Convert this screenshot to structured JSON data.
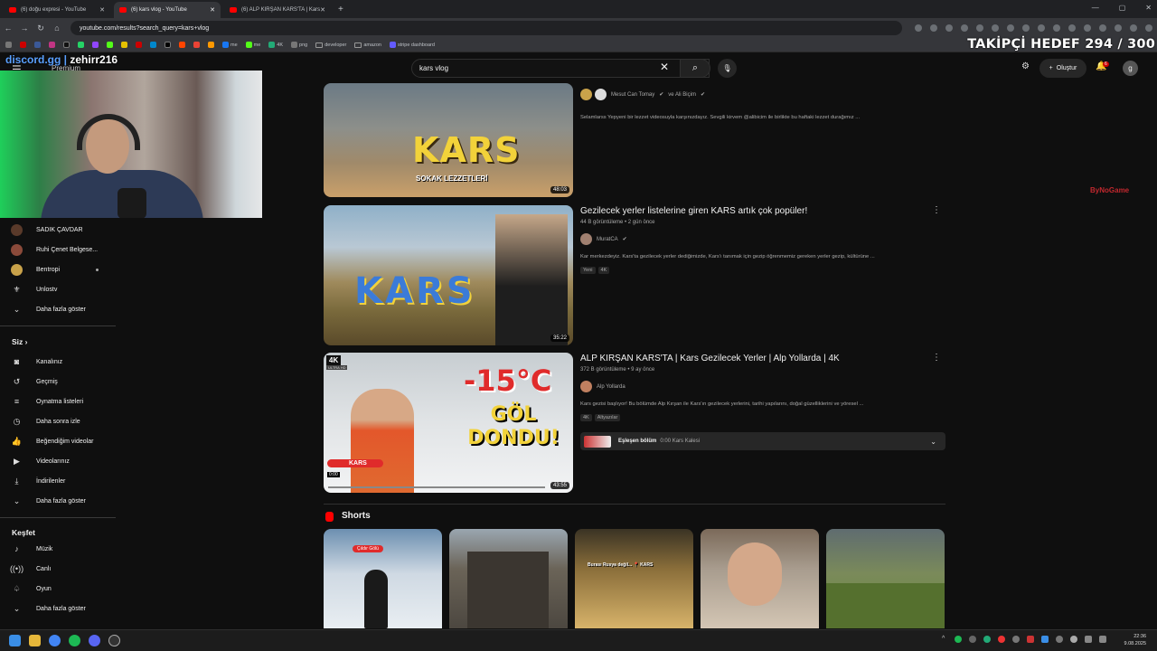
{
  "browser": {
    "tabs": [
      {
        "title": "(6) doğu expresi - YouTube",
        "active": false
      },
      {
        "title": "(6) kars vlog - YouTube",
        "active": true
      },
      {
        "title": "(6) ALP KIRŞAN KARS'TA | Kars",
        "active": false
      }
    ],
    "url": "youtube.com/results?search_query=kars+vlog",
    "bookmarks": [
      "me",
      "me",
      "4K",
      "png",
      "developer",
      "amazon",
      "stripe dashboard"
    ]
  },
  "stream_overlay": {
    "follower_goal": "TAKİPÇİ HEDEF 294 / 300",
    "discord_prefix": "discord.gg",
    "discord_name": "zehirr216",
    "watermark": "ByNoGame"
  },
  "header": {
    "premium": "Premium",
    "search_value": "kars vlog",
    "create_label": "Oluştur",
    "notification_count": "6",
    "avatar_letter": "g"
  },
  "sidebar": {
    "subscriptions": [
      {
        "label": "SADIK ÇAVDAR",
        "new": false
      },
      {
        "label": "Ruhi Çenet Belgese...",
        "new": false
      },
      {
        "label": "Bentropi",
        "new": true
      },
      {
        "label": "Unlostv",
        "new": false
      }
    ],
    "subs_more": "Daha fazla göster",
    "you_header": "Siz",
    "you_items": [
      "Kanalınız",
      "Geçmiş",
      "Oynatma listeleri",
      "Daha sonra izle",
      "Beğendiğim videolar",
      "Videolarınız",
      "İndirilenler"
    ],
    "you_more": "Daha fazla göster",
    "explore_header": "Keşfet",
    "explore_items": [
      "Müzik",
      "Canlı",
      "Oyun"
    ],
    "explore_more": "Daha fazla göster"
  },
  "videos": [
    {
      "thumb_text": "KARS",
      "thumb_sub": "SOKAK LEZZETLERİ",
      "duration": "48:03",
      "channel": "Mesut Can Tomay",
      "channel_extra": "ve Ali Biçim",
      "description": "Selamlarss Yepyeni bir lezzet videosuyla karşınızdayız. Sevgili kirvem @alibicim ile birlikte bu haftaki lezzet durağımız ..."
    },
    {
      "title": "Gezilecek yerler listelerine giren KARS artık çok popüler!",
      "meta": "44 B görüntüleme • 2 gün önce",
      "channel": "MuratCA",
      "description": "Kar merkezdeyiz. Kars'ta gezilecek yerler dediğimizde, Kars'ı tanımak için gezip öğrenmemiz gereken yerler gezip, kültürüne ...",
      "tags": [
        "Yeni",
        "4K"
      ],
      "thumb_text": "KARS",
      "duration": "35:22"
    },
    {
      "title": "ALP KIRŞAN KARS'TA | Kars Gezilecek Yerler | Alp Yollarda | 4K",
      "meta": "372 B görüntüleme • 9 ay önce",
      "channel": "Alp Yollarda",
      "description": "Kars gezisi başlıyor! Bu bölümde Alp Kırşan ile Kars'ın gezilecek yerlerini, tarihi yapılarını, doğal güzelliklerini ve yöresel ...",
      "tags": [
        "4K",
        "Altyazılar"
      ],
      "thumb_text_1": "-15°C",
      "thumb_text_2": "GÖL DONDU!",
      "thumb_badge": "4K",
      "thumb_badge_sub": "ULTRA HD",
      "thumb_pin": "KARS",
      "thumb_time": "0:00",
      "duration": "43:55",
      "chapter_label": "Eşleşen bölüm",
      "chapter_detail": "0:00 Kars Kalesi"
    }
  ],
  "shorts": {
    "header": "Shorts",
    "items": [
      {
        "overlay": "Çıldır Gölü"
      },
      {
        "overlay": ""
      },
      {
        "overlay": "Burası Rusya değil... 📍 KARS"
      },
      {
        "overlay": ""
      },
      {
        "overlay": ""
      }
    ]
  },
  "taskbar": {
    "time": "22:36",
    "date": "9.08.2025"
  },
  "colors": {
    "yt_red": "#ff0000",
    "background": "#0f0f0f",
    "kars_yellow": "#f2d23a",
    "temp_red": "#e02b2b"
  }
}
